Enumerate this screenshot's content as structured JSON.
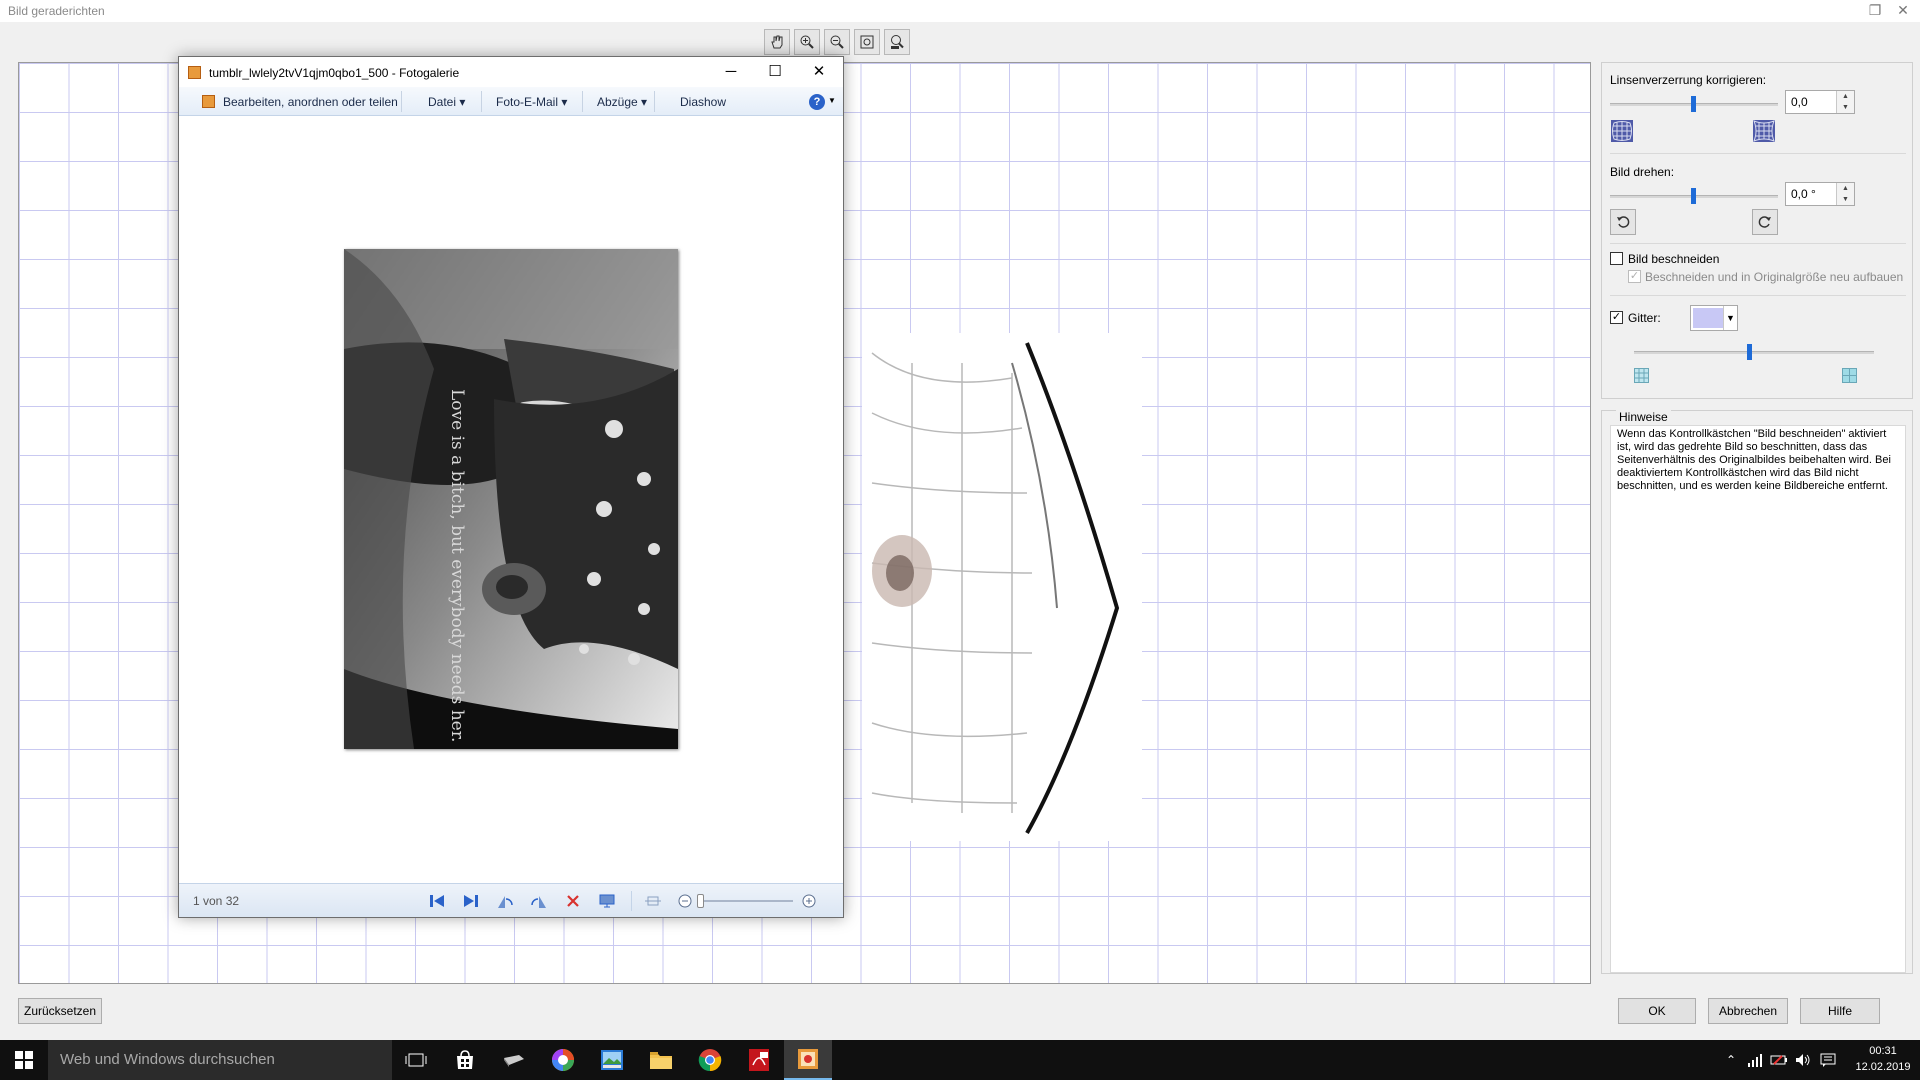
{
  "window": {
    "title": "Bild geraderichten"
  },
  "panel": {
    "lens_label": "Linsenverzerrung korrigieren:",
    "lens_value": 0.0,
    "lens_value_text": "0,0",
    "rotate_label": "Bild drehen:",
    "rotate_value": 0.0,
    "rotate_value_text": "0,0 °",
    "crop_label": "Bild beschneiden",
    "crop_checked": false,
    "crop_sub_label": "Beschneiden und in Originalgröße neu aufbauen",
    "crop_sub_checked": true,
    "grid_label": "Gitter:",
    "grid_checked": true,
    "grid_color": "#c8c8f5",
    "grid_size_level": 0.48
  },
  "hints": {
    "title": "Hinweise",
    "text": "Wenn das Kontrollkästchen \"Bild beschneiden\" aktiviert ist, wird das gedrehte Bild so beschnitten, dass das Seitenverhältnis des Originalbildes beibehalten wird. Bei deaktiviertem Kontrollkästchen wird das Bild nicht beschnitten, und es werden keine Bildbereiche entfernt."
  },
  "buttons": {
    "reset": "Zurücksetzen",
    "ok": "OK",
    "cancel": "Abbrechen",
    "help": "Hilfe"
  },
  "toolbar": {
    "icons": [
      "hand-icon",
      "zoom-in-icon",
      "zoom-out-icon",
      "fit-window-icon",
      "actual-size-icon"
    ]
  },
  "gallery": {
    "title": "tumblr_lwlely2tvV1qjm0qbo1_500 - Fotogalerie",
    "menu": [
      "Bearbeiten, anordnen oder teilen",
      "Datei",
      "Foto-E-Mail",
      "Abzüge",
      "Diashow"
    ],
    "photo_caption": "Love is a bitch, but everybody needs her.",
    "counter": "1 von 32"
  },
  "taskbar": {
    "search_placeholder": "Web und Windows durchsuchen",
    "time": "00:31",
    "date": "12.02.2019"
  }
}
